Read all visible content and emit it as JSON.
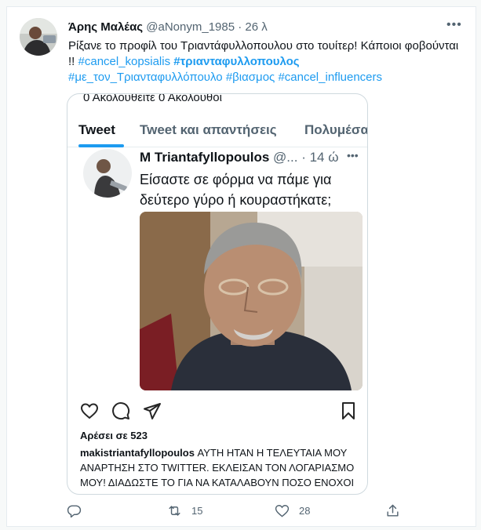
{
  "tweet": {
    "author_name": "Άρης Μαλέας",
    "handle": "@aNonym_1985",
    "separator": "·",
    "time": "26 λ",
    "more_glyph": "•••",
    "text_prefix": "Ρίξανε το προφίλ του Τριαντάφυλλοπουλου στο τουίτερ! Κάποιοι φοβούνται !! ",
    "hashtags": [
      "#cancel_kopsialis",
      "#τριανταφυλλοπουλος",
      "#με_τον_Τριανταφυλλόπουλο",
      "#βιασμος",
      "#cancel_influencers"
    ]
  },
  "screenshot": {
    "follows_text": "0 Ακολουθείτε  0 Ακόλουθοι",
    "tabs": [
      {
        "label": "Tweet",
        "active": true
      },
      {
        "label": "Tweet και απαντήσεις",
        "active": false
      },
      {
        "label": "Πολυμέσα",
        "active": false
      }
    ],
    "inner_author": "M Triantafyllopoulos",
    "inner_handle": "@...",
    "inner_time": "· 14 ώ",
    "inner_more": "•••",
    "inner_text": "Είσαστε σε φόρμα να πάμε για δεύτερο γύρο ή κουραστήκατε;",
    "likes": "Αρέσει σε 523",
    "caption_user": "makistriantafyllopoulos",
    "caption_text": " ΑΥΤΗ ΗΤΑΝ Η ΤΕΛΕΥΤΑΙΑ ΜΟΥ ΑΝΑΡΤΗΣΗ ΣΤΟ TWITTER. ΕΚΛΕΙΣΑΝ ΤΟΝ ΛΟΓΑΡΙΑΣΜΟ ΜΟΥ! ΔΙΑΔΩΣΤΕ ΤΟ ΓΙΑ ΝΑ ΚΑΤΑΛΑΒΟΥΝ ΠΟΣΟ ΕΝΟΧΟΙ ΕΙΝΑΙ ΟΤΑΝ ΚΑΝΟΥΝ"
  },
  "actions": {
    "retweets": "15",
    "likes": "28"
  },
  "icons": {
    "reply": "reply-icon",
    "retweet": "retweet-icon",
    "like": "heart-icon",
    "share": "share-icon"
  },
  "colors": {
    "accent": "#1d9bf0",
    "muted": "#536471",
    "text": "#0f1419"
  }
}
